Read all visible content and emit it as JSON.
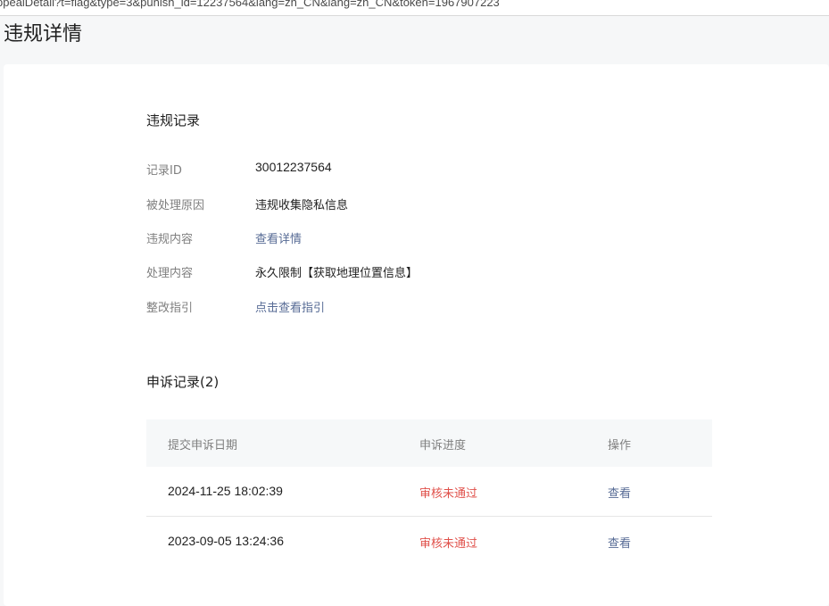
{
  "url": "ppealDetail?t=flag&type=3&punish_id=12237564&lang=zh_CN&lang=zh_CN&token=1967907223",
  "page_title": "违规详情",
  "violation": {
    "title": "违规记录",
    "id_label": "记录ID",
    "id_value": "30012237564",
    "reason_label": "被处理原因",
    "reason_value": "违规收集隐私信息",
    "content_label": "违规内容",
    "content_link": "查看详情",
    "handling_label": "处理内容",
    "handling_value": "永久限制【获取地理位置信息】",
    "guide_label": "整改指引",
    "guide_link": "点击查看指引"
  },
  "appeals": {
    "title": "申诉记录(2)",
    "columns": [
      "提交申诉日期",
      "申诉进度",
      "操作"
    ],
    "rows": [
      {
        "date": "2024-11-25 18:02:39",
        "status": "审核未通过",
        "action": "查看"
      },
      {
        "date": "2023-09-05 13:24:36",
        "status": "审核未通过",
        "action": "查看"
      }
    ]
  },
  "colors": {
    "link": "#576b95",
    "status_rejected": "#e0514b"
  }
}
